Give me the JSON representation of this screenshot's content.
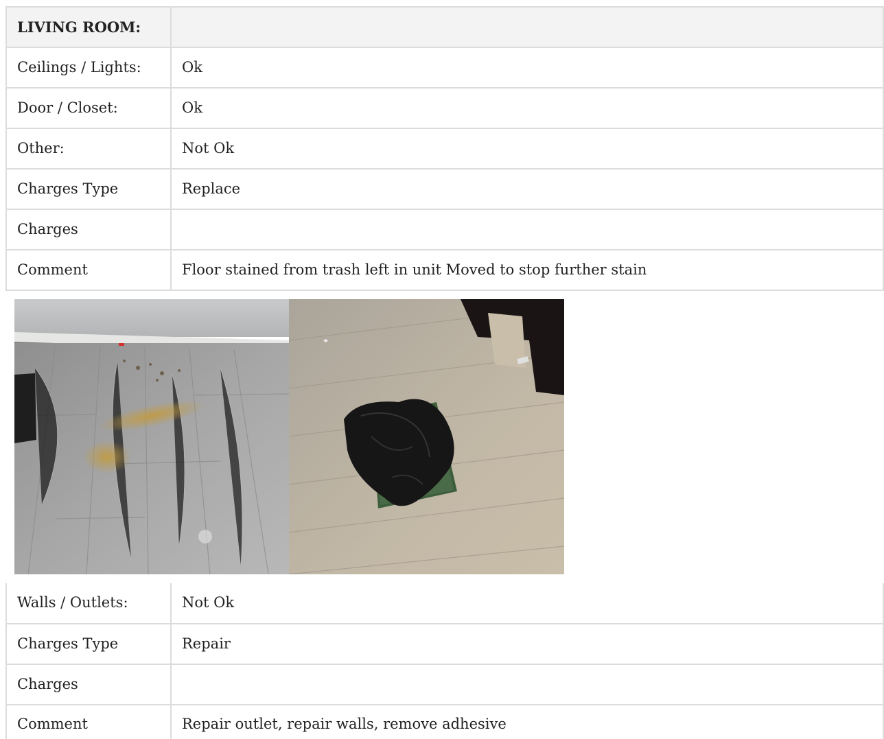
{
  "section_title": "LIVING ROOM:",
  "rows_top": [
    {
      "label": "Ceilings / Lights:",
      "value": "Ok"
    },
    {
      "label": "Door / Closet:",
      "value": "Ok"
    },
    {
      "label": "Other:",
      "value": "Not Ok"
    },
    {
      "label": "Charges Type",
      "value": "Replace"
    },
    {
      "label": "Charges",
      "value": ""
    },
    {
      "label": "Comment",
      "value": "Floor stained from trash left in unit Moved to stop further stain"
    }
  ],
  "photos": [
    {
      "subject": "stained-gray-wood-floor"
    },
    {
      "subject": "trash-bag-on-green-tray"
    }
  ],
  "rows_bottom": [
    {
      "label": "Walls / Outlets:",
      "value": "Not Ok"
    },
    {
      "label": "Charges Type",
      "value": "Repair"
    },
    {
      "label": "Charges",
      "value": ""
    },
    {
      "label": "Comment",
      "value": "Repair outlet, repair walls, remove adhesive"
    }
  ]
}
